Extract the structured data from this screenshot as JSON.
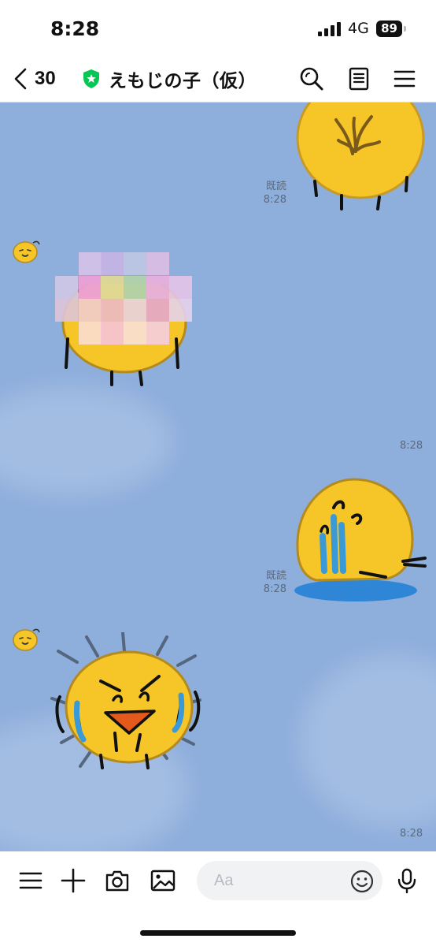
{
  "status_bar": {
    "time": "8:28",
    "network": "4G",
    "battery": "89"
  },
  "header": {
    "back_count": "30",
    "room_name": "えもじの子（仮）"
  },
  "messages": [
    {
      "side": "right",
      "read_label": "既読",
      "time": "8:28",
      "sticker": "emoji-blob-with-hair-sticker"
    },
    {
      "side": "left",
      "time": "8:28",
      "sticker": "censored-emoji-blob-sticker"
    },
    {
      "side": "right",
      "read_label": "既読",
      "time": "8:28",
      "sticker": "melting-crying-emoji-sticker"
    },
    {
      "side": "left",
      "time": "8:28",
      "sticker": "shouting-crying-emoji-sticker"
    }
  ],
  "input": {
    "placeholder": "Aa"
  },
  "colors": {
    "chat_background": "#8eaedc",
    "sticker_yellow": "#f6c528",
    "verified_green": "#06c755"
  }
}
